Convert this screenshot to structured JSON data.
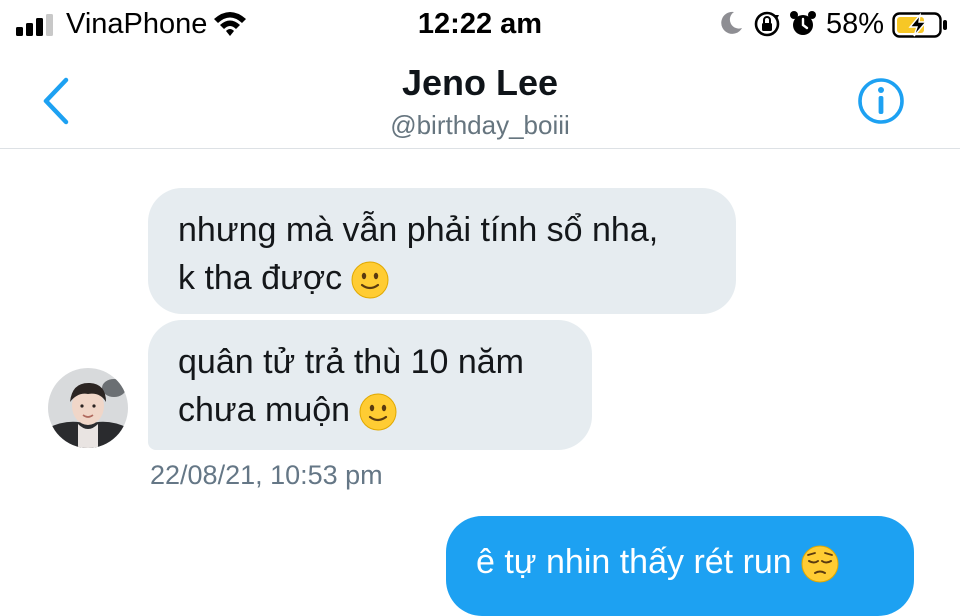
{
  "status_bar": {
    "carrier": "VinaPhone",
    "time": "12:22 am",
    "battery_percent": "58%",
    "icons": [
      "signal-icon",
      "wifi-icon",
      "moon-icon",
      "orientation-lock-icon",
      "alarm-icon",
      "battery-charging-icon"
    ]
  },
  "header": {
    "name": "Jeno Lee",
    "handle": "@birthday_boiii",
    "back_icon": "chevron-left-icon",
    "info_icon": "info-icon",
    "accent": "#1da1f2"
  },
  "messages": {
    "incoming": [
      {
        "lines": [
          "nhưng mà vẫn phải tính sổ nha,",
          "k tha được"
        ],
        "emoji": "slightly-smiling-face"
      },
      {
        "lines": [
          "quân tử trả thù 10 năm",
          "chưa muộn"
        ],
        "emoji": "slightly-smiling-face"
      }
    ],
    "incoming_timestamp": "22/08/21, 10:53 pm",
    "outgoing": [
      {
        "text": "ê tự nhin thấy rét run",
        "emoji": "pensive-face"
      }
    ]
  },
  "colors": {
    "incoming_bubble": "#e6ecf0",
    "outgoing_bubble": "#1da1f2",
    "timestamp": "#657786"
  }
}
